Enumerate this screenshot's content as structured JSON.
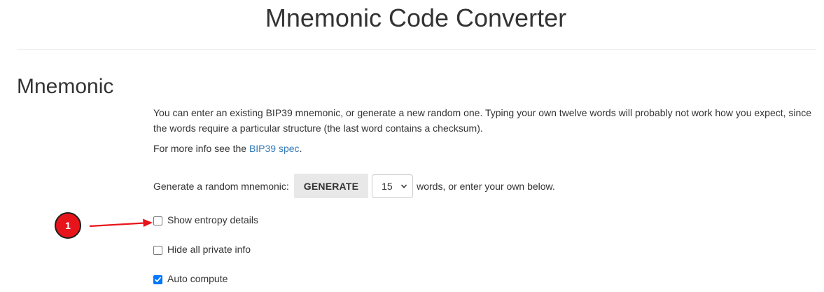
{
  "header": {
    "title": "Mnemonic Code Converter"
  },
  "section": {
    "heading": "Mnemonic",
    "intro_text": "You can enter an existing BIP39 mnemonic, or generate a new random one. Typing your own twelve words will probably not work how you expect, since the words require a particular structure (the last word contains a checksum).",
    "info_prefix": "For more info see the ",
    "info_link": "BIP39 spec",
    "info_suffix": "."
  },
  "generator": {
    "label": "Generate a random mnemonic:",
    "button_label": "GENERATE",
    "word_count_selected": "15",
    "suffix": "words, or enter your own below."
  },
  "options": {
    "show_entropy": {
      "label": "Show entropy details",
      "checked": false
    },
    "hide_private": {
      "label": "Hide all private info",
      "checked": false
    },
    "auto_compute": {
      "label": "Auto compute",
      "checked": true
    }
  },
  "annotation": {
    "badge_number": "1",
    "color": "#e8141b"
  },
  "colors": {
    "link": "#337ab7",
    "checkbox_checked": "#0075ff",
    "button_bg": "#e8e8e8"
  }
}
